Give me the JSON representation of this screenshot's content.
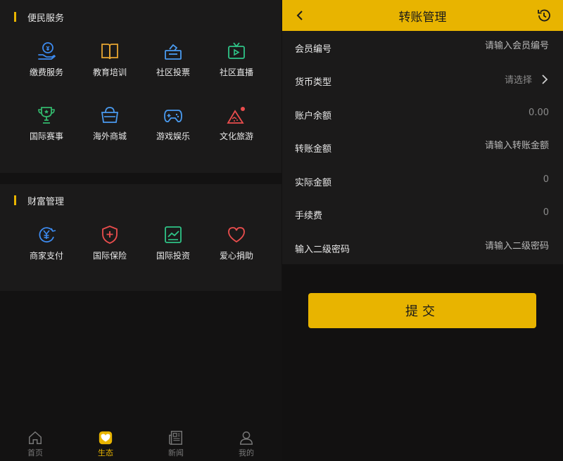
{
  "left": {
    "section1_title": "便民服务",
    "section1_items": [
      {
        "label": "缴费服务",
        "icon": "payment-icon",
        "color": "#3d8bf0"
      },
      {
        "label": "教育培训",
        "icon": "book-icon",
        "color": "#e8a631"
      },
      {
        "label": "社区投票",
        "icon": "vote-box-icon",
        "color": "#4a9bf0"
      },
      {
        "label": "社区直播",
        "icon": "tv-icon",
        "color": "#2fc487"
      },
      {
        "label": "国际赛事",
        "icon": "trophy-icon",
        "color": "#33b86d"
      },
      {
        "label": "海外商城",
        "icon": "basket-icon",
        "color": "#4a9bf0"
      },
      {
        "label": "游戏娱乐",
        "icon": "gamepad-icon",
        "color": "#4a9bf0"
      },
      {
        "label": "文化旅游",
        "icon": "mountain-icon",
        "color": "#ea4d4d"
      }
    ],
    "section2_title": "财富管理",
    "section2_items": [
      {
        "label": "商家支付",
        "icon": "yen-pay-icon",
        "color": "#3d8bf0"
      },
      {
        "label": "国际保险",
        "icon": "shield-plus-icon",
        "color": "#ea4d4d"
      },
      {
        "label": "国际投资",
        "icon": "chart-up-icon",
        "color": "#2fc487"
      },
      {
        "label": "爱心捐助",
        "icon": "heart-icon",
        "color": "#ea4d4d"
      }
    ]
  },
  "bottom_nav": [
    {
      "label": "首页",
      "icon": "home-icon",
      "active": false
    },
    {
      "label": "生态",
      "icon": "heart-badge-icon",
      "active": true
    },
    {
      "label": "新闻",
      "icon": "news-icon",
      "active": false
    },
    {
      "label": "我的",
      "icon": "user-icon",
      "active": false
    }
  ],
  "right": {
    "title": "转账管理",
    "accent": "#e8b400",
    "rows": [
      {
        "label": "会员编号",
        "placeholder": "请输入会员编号"
      },
      {
        "label": "货币类型",
        "value": "请选择"
      },
      {
        "label": "账户余额",
        "value": "0.00"
      },
      {
        "label": "转账金额",
        "placeholder": "请输入转账金额"
      },
      {
        "label": "实际金额",
        "value": "0"
      },
      {
        "label": "手续费",
        "value": "0"
      },
      {
        "label": "输入二级密码",
        "placeholder": "请输入二级密码"
      }
    ],
    "submit_label": "提交"
  }
}
